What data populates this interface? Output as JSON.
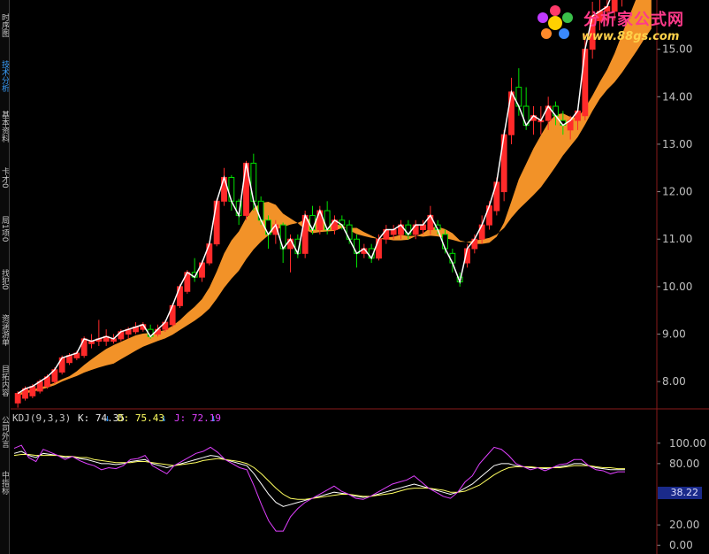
{
  "sidebar": {
    "tabs": [
      {
        "label": "时序图",
        "active": false
      },
      {
        "label": "技术分析",
        "active": true
      },
      {
        "label": "基本资料",
        "active": false
      },
      {
        "label": "卡才0",
        "active": false
      },
      {
        "label": "局1项0",
        "active": false
      },
      {
        "label": "找犯0",
        "active": false
      },
      {
        "label": "资涵游单",
        "active": false
      },
      {
        "label": "目拓内容",
        "active": false
      },
      {
        "label": "公司外言",
        "active": false
      },
      {
        "label": "中指标",
        "active": false
      }
    ]
  },
  "logo": {
    "brand": "分析家公式网",
    "url": "www.88gs.com"
  },
  "kdj": {
    "name": "KDJ(9,3,3)",
    "k_label": "K: 74.35",
    "d_label": "D: 75.43",
    "j_label": "J: 72.19",
    "arrow": "↓"
  },
  "badge": {
    "value": "38.22"
  },
  "colors": {
    "up": "#ff2a2a",
    "down": "#00e000",
    "ma_band": "#ff9a2a",
    "k": "#ffffff",
    "d": "#ffff60",
    "j": "#e040ff",
    "axis": "#8a8a8a"
  },
  "chart_data": [
    {
      "type": "candlestick",
      "title": "",
      "ylim": [
        7.5,
        16.0
      ],
      "y_ticks": [
        "8.00",
        "9.00",
        "10.00",
        "11.00",
        "12.00",
        "13.00",
        "14.00",
        "15.00"
      ],
      "candles": [
        [
          7.55,
          7.75,
          7.45,
          7.8
        ],
        [
          7.65,
          7.85,
          7.6,
          7.9
        ],
        [
          7.7,
          7.9,
          7.65,
          7.95
        ],
        [
          7.8,
          8.0,
          7.75,
          8.05
        ],
        [
          7.9,
          8.1,
          7.85,
          8.15
        ],
        [
          8.0,
          8.25,
          7.95,
          8.3
        ],
        [
          8.2,
          8.5,
          8.15,
          8.55
        ],
        [
          8.4,
          8.55,
          8.35,
          8.6
        ],
        [
          8.5,
          8.6,
          8.45,
          8.65
        ],
        [
          8.55,
          8.9,
          8.5,
          8.95
        ],
        [
          8.8,
          8.85,
          8.7,
          9.0
        ],
        [
          8.85,
          8.9,
          8.75,
          9.3
        ],
        [
          8.85,
          8.95,
          8.75,
          9.1
        ],
        [
          8.85,
          8.9,
          8.8,
          9.0
        ],
        [
          8.9,
          9.05,
          8.85,
          9.1
        ],
        [
          9.0,
          9.1,
          8.9,
          9.15
        ],
        [
          9.05,
          9.15,
          9.0,
          9.25
        ],
        [
          9.1,
          9.2,
          9.05,
          9.25
        ],
        [
          9.1,
          8.95,
          8.9,
          9.2
        ],
        [
          9.0,
          9.1,
          8.95,
          9.2
        ],
        [
          9.1,
          9.25,
          9.05,
          9.3
        ],
        [
          9.2,
          9.6,
          9.15,
          9.65
        ],
        [
          9.6,
          10.0,
          9.55,
          10.05
        ],
        [
          9.9,
          10.3,
          9.85,
          10.35
        ],
        [
          10.3,
          10.2,
          10.1,
          10.6
        ],
        [
          10.2,
          10.5,
          10.1,
          10.55
        ],
        [
          10.5,
          10.9,
          10.45,
          10.95
        ],
        [
          10.9,
          11.8,
          10.85,
          11.85
        ],
        [
          11.8,
          12.3,
          11.7,
          12.5
        ],
        [
          12.3,
          11.8,
          11.6,
          12.35
        ],
        [
          11.8,
          11.5,
          11.3,
          11.85
        ],
        [
          11.5,
          12.6,
          11.4,
          12.65
        ],
        [
          12.6,
          11.8,
          11.6,
          12.8
        ],
        [
          11.8,
          11.4,
          11.3,
          11.9
        ],
        [
          11.4,
          11.1,
          10.8,
          11.5
        ],
        [
          11.1,
          11.3,
          10.9,
          11.4
        ],
        [
          11.3,
          10.8,
          10.5,
          11.35
        ],
        [
          10.8,
          11.0,
          10.3,
          11.1
        ],
        [
          11.0,
          10.7,
          10.6,
          11.1
        ],
        [
          10.7,
          11.5,
          10.6,
          11.6
        ],
        [
          11.5,
          11.2,
          11.1,
          11.7
        ],
        [
          11.2,
          11.6,
          11.1,
          11.7
        ],
        [
          11.6,
          11.2,
          11.1,
          11.8
        ],
        [
          11.2,
          11.4,
          11.1,
          11.5
        ],
        [
          11.4,
          11.3,
          11.2,
          11.5
        ],
        [
          11.3,
          11.0,
          10.9,
          11.4
        ],
        [
          11.0,
          10.7,
          10.4,
          11.1
        ],
        [
          10.7,
          10.8,
          10.6,
          10.9
        ],
        [
          10.8,
          10.6,
          10.5,
          10.9
        ],
        [
          10.6,
          11.0,
          10.55,
          11.1
        ],
        [
          11.0,
          11.2,
          10.9,
          11.3
        ],
        [
          11.1,
          11.2,
          11.0,
          11.3
        ],
        [
          11.1,
          11.3,
          11.0,
          11.4
        ],
        [
          11.3,
          11.1,
          11.0,
          11.4
        ],
        [
          11.1,
          11.3,
          11.0,
          11.4
        ],
        [
          11.2,
          11.3,
          11.1,
          11.4
        ],
        [
          11.2,
          11.5,
          11.1,
          11.7
        ],
        [
          11.3,
          11.2,
          11.1,
          11.4
        ],
        [
          11.1,
          10.8,
          10.7,
          11.2
        ],
        [
          10.7,
          10.5,
          10.3,
          10.8
        ],
        [
          10.2,
          10.1,
          10.0,
          10.3
        ],
        [
          10.5,
          10.8,
          10.4,
          10.9
        ],
        [
          10.8,
          11.0,
          10.7,
          11.1
        ],
        [
          11.0,
          11.3,
          10.9,
          11.5
        ],
        [
          11.3,
          11.7,
          11.2,
          11.8
        ],
        [
          11.6,
          12.2,
          11.5,
          12.3
        ],
        [
          12.0,
          13.2,
          11.8,
          13.3
        ],
        [
          13.2,
          14.1,
          13.0,
          14.4
        ],
        [
          14.2,
          13.8,
          13.6,
          14.6
        ],
        [
          13.8,
          13.4,
          13.3,
          14.2
        ],
        [
          13.5,
          13.6,
          13.2,
          13.8
        ],
        [
          13.5,
          13.5,
          13.2,
          13.8
        ],
        [
          13.5,
          13.8,
          13.3,
          14.0
        ],
        [
          13.8,
          13.6,
          13.4,
          13.9
        ],
        [
          13.5,
          13.4,
          13.2,
          13.7
        ],
        [
          13.3,
          13.5,
          13.1,
          13.6
        ],
        [
          13.5,
          13.7,
          13.3,
          13.7
        ],
        [
          13.6,
          15.0,
          13.5,
          15.3
        ],
        [
          15.0,
          15.7,
          14.8,
          16.0
        ],
        [
          15.6,
          15.8,
          15.4,
          16.2
        ],
        [
          15.8,
          15.9,
          15.5,
          16.1
        ],
        [
          15.8,
          16.3,
          15.6,
          16.5
        ],
        [
          16.1,
          16.6,
          15.9,
          16.8
        ],
        [
          16.5,
          16.6,
          16.2,
          16.8
        ],
        [
          16.6,
          16.8,
          16.4,
          16.9
        ],
        [
          16.7,
          16.9,
          16.5,
          17.0
        ],
        [
          16.8,
          16.9,
          16.6,
          17.0
        ]
      ]
    },
    {
      "type": "line",
      "title": "KDJ(9,3,3)",
      "ylim": [
        -5,
        118
      ],
      "y_ticks": [
        "0.00",
        "20.00",
        "80.00",
        "100.00"
      ],
      "series": [
        {
          "name": "K",
          "values": [
            90,
            92,
            88,
            86,
            90,
            89,
            88,
            86,
            87,
            85,
            84,
            82,
            80,
            80,
            79,
            80,
            82,
            83,
            84,
            80,
            78,
            76,
            78,
            80,
            82,
            84,
            86,
            88,
            87,
            84,
            82,
            80,
            78,
            70,
            60,
            50,
            42,
            38,
            40,
            42,
            44,
            46,
            48,
            50,
            52,
            51,
            50,
            48,
            47,
            48,
            50,
            52,
            54,
            56,
            58,
            60,
            58,
            56,
            54,
            52,
            50,
            52,
            56,
            60,
            66,
            72,
            78,
            80,
            80,
            78,
            77,
            76,
            76,
            75,
            76,
            77,
            78,
            80,
            80,
            78,
            76,
            75,
            74,
            74,
            74
          ]
        },
        {
          "name": "D",
          "values": [
            88,
            89,
            89,
            88,
            88,
            88,
            88,
            87,
            87,
            86,
            86,
            84,
            83,
            82,
            81,
            81,
            81,
            82,
            82,
            81,
            80,
            79,
            78,
            79,
            80,
            81,
            83,
            84,
            85,
            84,
            83,
            82,
            80,
            76,
            70,
            63,
            56,
            50,
            46,
            45,
            45,
            46,
            47,
            48,
            49,
            50,
            50,
            49,
            48,
            48,
            49,
            50,
            51,
            53,
            55,
            56,
            56,
            56,
            55,
            54,
            52,
            52,
            53,
            56,
            59,
            64,
            69,
            73,
            76,
            77,
            77,
            77,
            76,
            76,
            76,
            76,
            77,
            78,
            78,
            78,
            77,
            76,
            76,
            75,
            75
          ]
        },
        {
          "name": "J",
          "values": [
            95,
            98,
            86,
            82,
            94,
            91,
            88,
            84,
            87,
            83,
            80,
            78,
            74,
            76,
            75,
            78,
            84,
            85,
            88,
            78,
            74,
            70,
            78,
            82,
            86,
            90,
            92,
            96,
            91,
            84,
            80,
            76,
            74,
            58,
            40,
            24,
            14,
            14,
            28,
            36,
            42,
            46,
            50,
            54,
            58,
            53,
            50,
            46,
            45,
            48,
            52,
            56,
            60,
            62,
            64,
            68,
            62,
            56,
            52,
            48,
            46,
            52,
            62,
            68,
            80,
            88,
            96,
            94,
            88,
            80,
            77,
            74,
            76,
            73,
            76,
            79,
            80,
            84,
            84,
            78,
            74,
            73,
            70,
            72,
            72
          ]
        }
      ]
    }
  ]
}
